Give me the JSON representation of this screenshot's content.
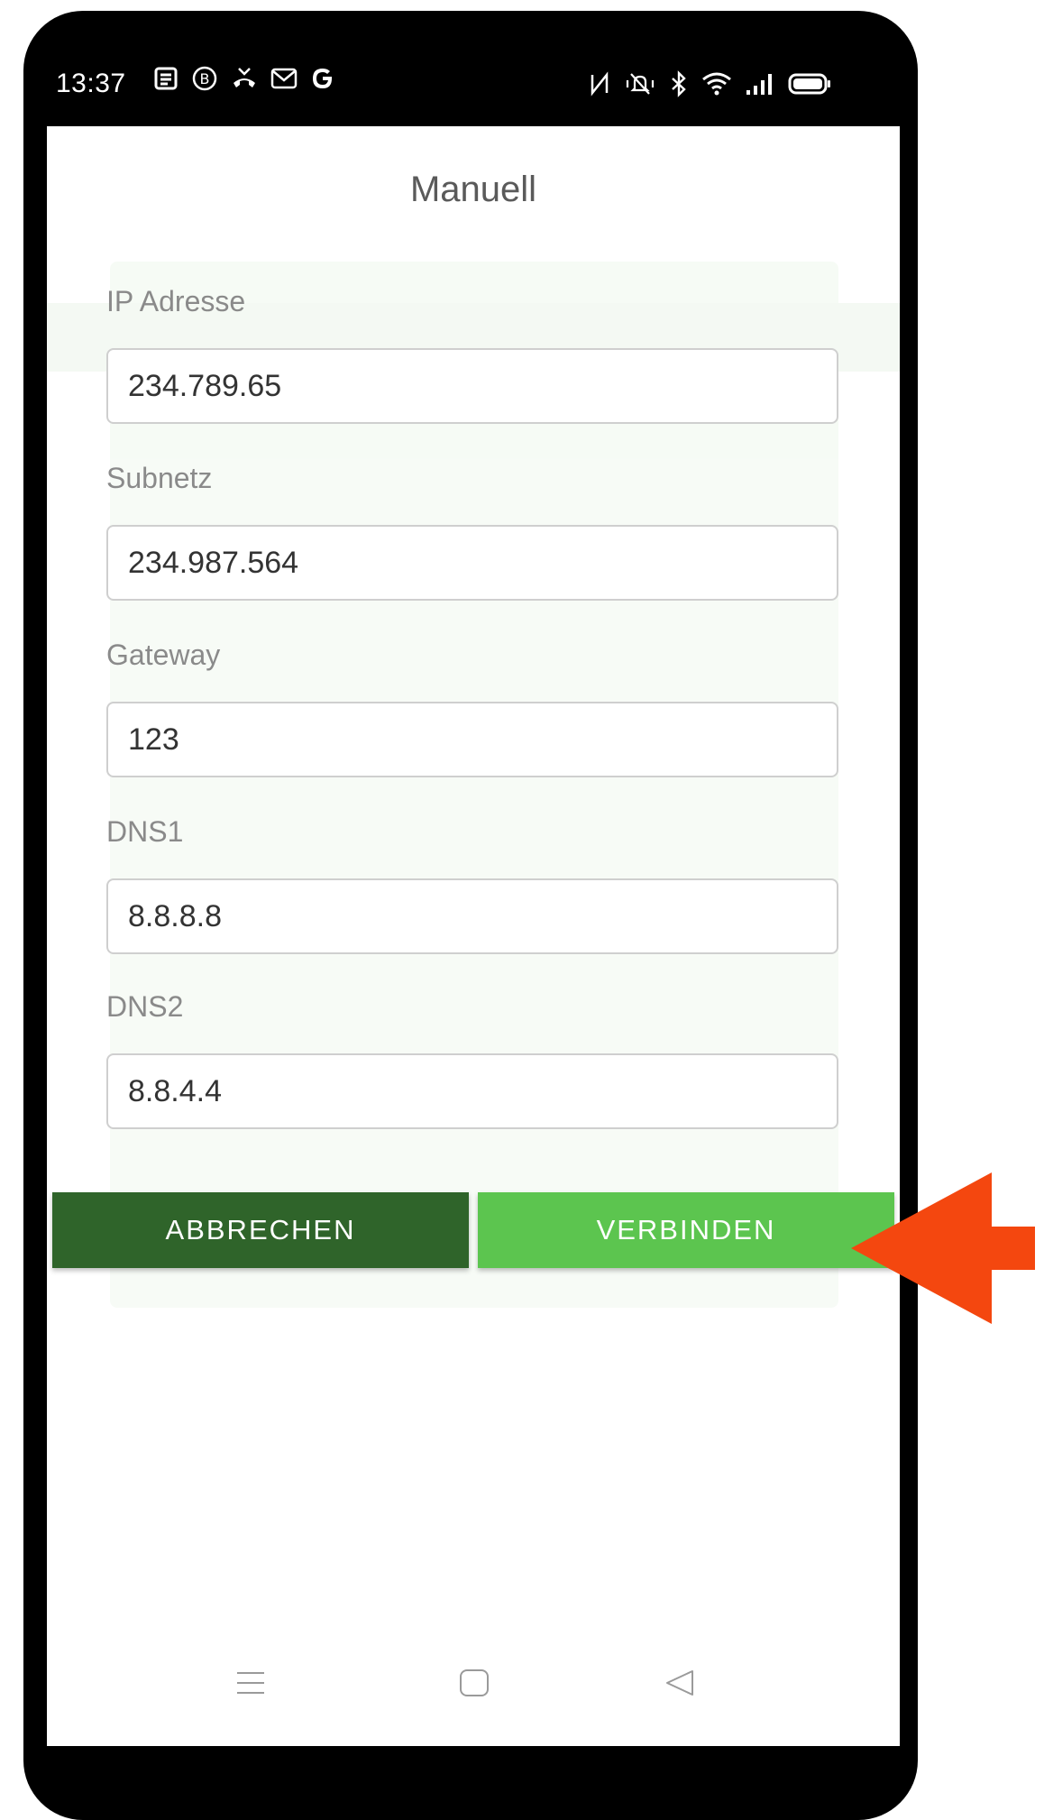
{
  "status_bar": {
    "time": "13:37",
    "left_icons": [
      "notes-icon",
      "b-circle-icon",
      "missed-call-icon",
      "gmail-icon",
      "google-icon"
    ],
    "right_icons": [
      "nfc-icon",
      "vibrate-icon",
      "bluetooth-icon",
      "wifi-icon",
      "signal-icon",
      "battery-icon"
    ]
  },
  "dialog": {
    "title": "Manuell",
    "fields": [
      {
        "label": "IP Adresse",
        "value": "234.789.65"
      },
      {
        "label": "Subnetz",
        "value": "234.987.564"
      },
      {
        "label": "Gateway",
        "value": "123"
      },
      {
        "label": "DNS1",
        "value": "8.8.8.8"
      },
      {
        "label": "DNS2",
        "value": "8.8.4.4"
      }
    ],
    "cancel_label": "ABBRECHEN",
    "connect_label": "VERBINDEN"
  },
  "nav_bar": {
    "icons": [
      "menu-icon",
      "home-icon",
      "back-icon"
    ]
  },
  "colors": {
    "cancel_button": "#2f642a",
    "connect_button": "#5cc54f",
    "arrow": "#f4470f"
  }
}
